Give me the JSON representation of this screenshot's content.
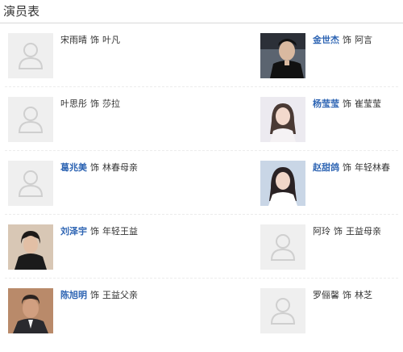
{
  "section_title": "演员表",
  "separator": "饰",
  "cast": [
    {
      "actor": "宋雨晴",
      "role": "叶凡",
      "linked": false,
      "photo": "placeholder"
    },
    {
      "actor": "金世杰",
      "role": "阿言",
      "linked": true,
      "photo": "man-dark-hair"
    },
    {
      "actor": "叶思彤",
      "role": "莎拉",
      "linked": false,
      "photo": "placeholder"
    },
    {
      "actor": "杨莹莹",
      "role": "崔莹莹",
      "linked": true,
      "photo": "woman-light"
    },
    {
      "actor": "葛兆美",
      "role": "林春母亲",
      "linked": true,
      "photo": "placeholder"
    },
    {
      "actor": "赵甜鸽",
      "role": "年轻林春",
      "linked": true,
      "photo": "woman-white"
    },
    {
      "actor": "刘泽宇",
      "role": "年轻王益",
      "linked": true,
      "photo": "man-young"
    },
    {
      "actor": "阿玲",
      "role": "王益母亲",
      "linked": false,
      "photo": "placeholder"
    },
    {
      "actor": "陈旭明",
      "role": "王益父亲",
      "linked": true,
      "photo": "man-older"
    },
    {
      "actor": "罗俪馨",
      "role": "林芝",
      "linked": false,
      "photo": "placeholder"
    }
  ],
  "colors": {
    "link": "#2d64b3",
    "text": "#333333",
    "placeholder_bg": "#efefef",
    "placeholder_icon": "#cfcfcf"
  }
}
